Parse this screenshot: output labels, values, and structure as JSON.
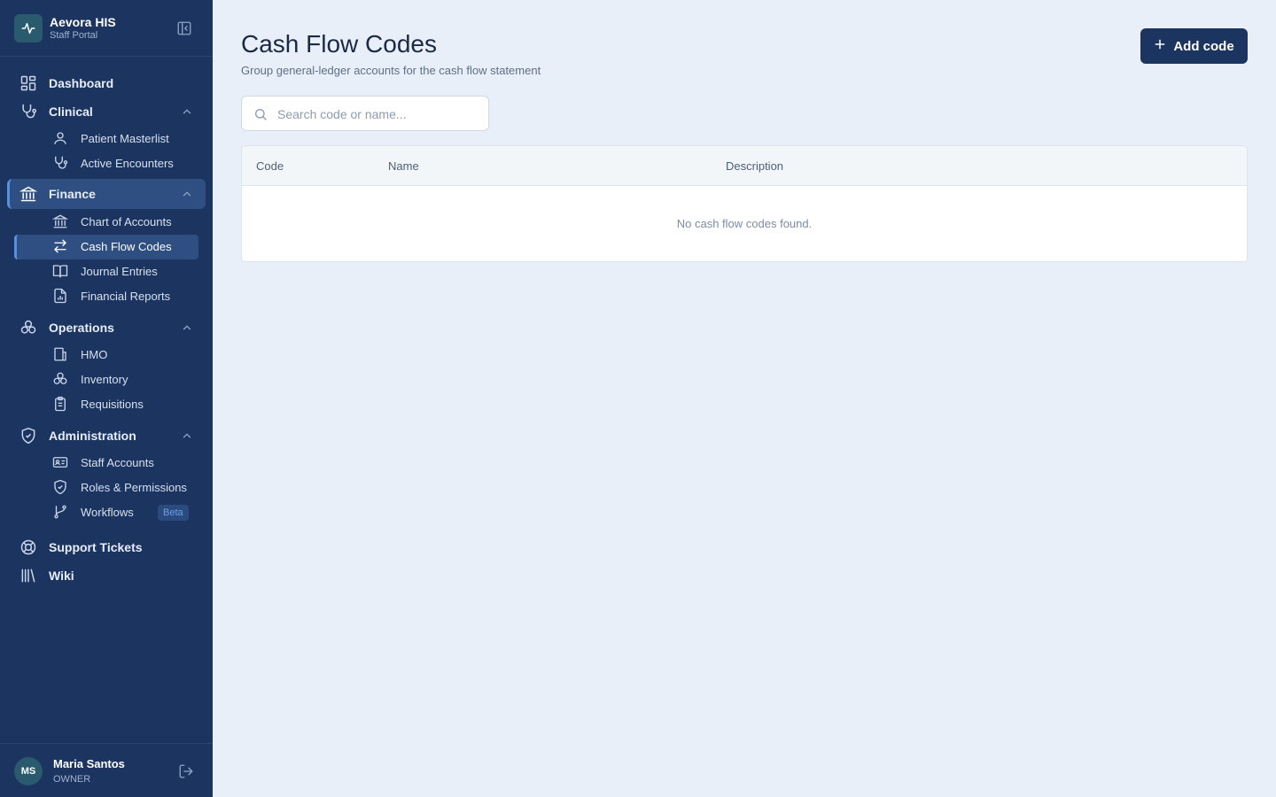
{
  "app": {
    "title": "Aevora HIS",
    "subtitle": "Staff Portal"
  },
  "nav": {
    "dashboard": "Dashboard",
    "clinical": {
      "label": "Clinical",
      "items": [
        "Patient Masterlist",
        "Active Encounters"
      ]
    },
    "finance": {
      "label": "Finance",
      "items": [
        "Chart of Accounts",
        "Cash Flow Codes",
        "Journal Entries",
        "Financial Reports"
      ]
    },
    "operations": {
      "label": "Operations",
      "items": [
        "HMO",
        "Inventory",
        "Requisitions"
      ]
    },
    "administration": {
      "label": "Administration",
      "items": [
        "Staff Accounts",
        "Roles & Permissions",
        "Workflows"
      ],
      "beta_badge": "Beta"
    },
    "support": "Support Tickets",
    "wiki": "Wiki"
  },
  "user": {
    "initials": "MS",
    "name": "Maria Santos",
    "role": "OWNER"
  },
  "page": {
    "title": "Cash Flow Codes",
    "subtitle": "Group general-ledger accounts for the cash flow statement",
    "add_button": "Add code"
  },
  "search": {
    "placeholder": "Search code or name...",
    "value": ""
  },
  "table": {
    "columns": [
      "Code",
      "Name",
      "Description"
    ],
    "rows": [],
    "empty_message": "No cash flow codes found."
  },
  "colors": {
    "sidebar": "#1c3460",
    "accent": "#5b8fd9",
    "background": "#e8eff9"
  }
}
